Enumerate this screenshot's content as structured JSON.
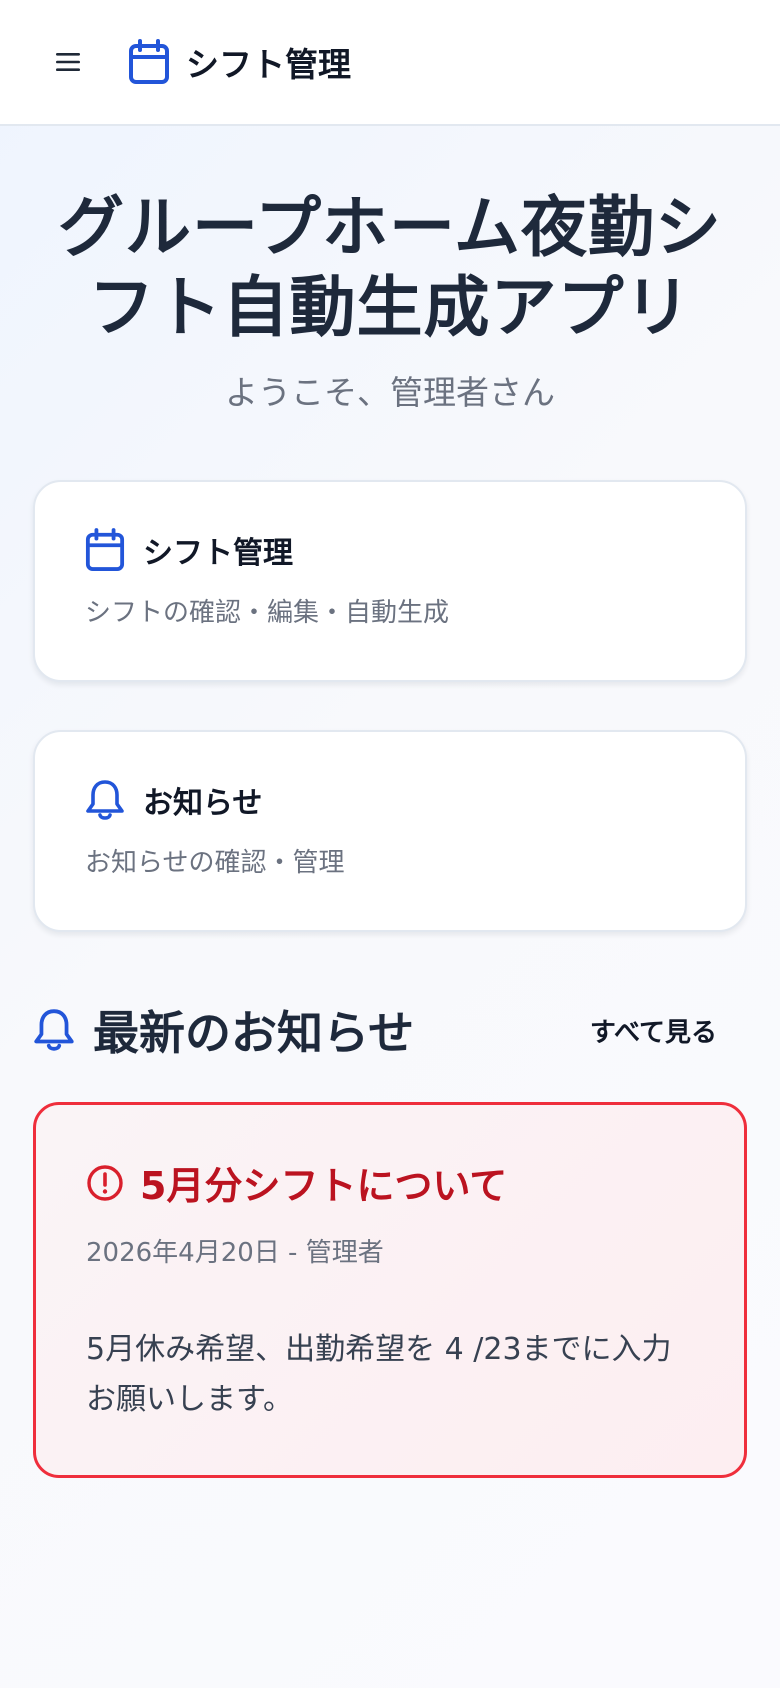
{
  "header": {
    "title": "シフト管理",
    "menu_icon": "hamburger-menu-icon",
    "logo_icon": "calendar-icon"
  },
  "hero": {
    "title": "グループホーム夜勤シフト自動生成アプリ",
    "subtitle": "ようこそ、管理者さん"
  },
  "cards": [
    {
      "icon": "calendar-icon",
      "title": "シフト管理",
      "description": "シフトの確認・編集・自動生成"
    },
    {
      "icon": "bell-icon",
      "title": "お知らせ",
      "description": "お知らせの確認・管理"
    }
  ],
  "announcements": {
    "icon": "bell-icon",
    "title": "最新のお知らせ",
    "see_all_label": "すべて見る",
    "items": [
      {
        "icon": "alert-circle-icon",
        "title": "5月分シフトについて",
        "meta": "2026年4月20日 - 管理者",
        "body": "5月休み希望、出勤希望を 4 /23までに入力お願いします。"
      }
    ]
  },
  "colors": {
    "accent": "#2255d9",
    "alert": "#ef2e3c",
    "alert_text": "#bb1320",
    "heading": "#1e293b",
    "muted": "#6b7280"
  }
}
